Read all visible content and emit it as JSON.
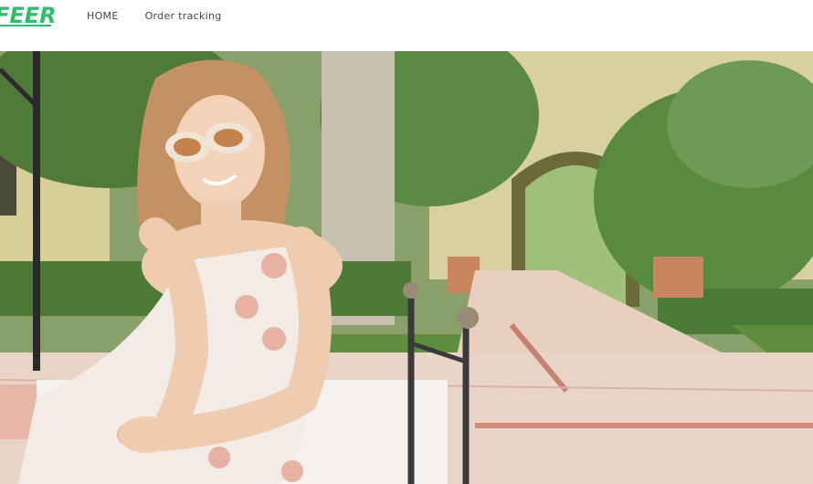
{
  "header": {
    "logo_text": "FEER",
    "nav": [
      {
        "label": "HOME"
      },
      {
        "label": "Order tracking"
      }
    ]
  },
  "colors": {
    "brand": "#2ebf6e",
    "nav_text": "#444444",
    "background": "#ffffff"
  },
  "hero": {
    "image_label": "hero-banner"
  }
}
